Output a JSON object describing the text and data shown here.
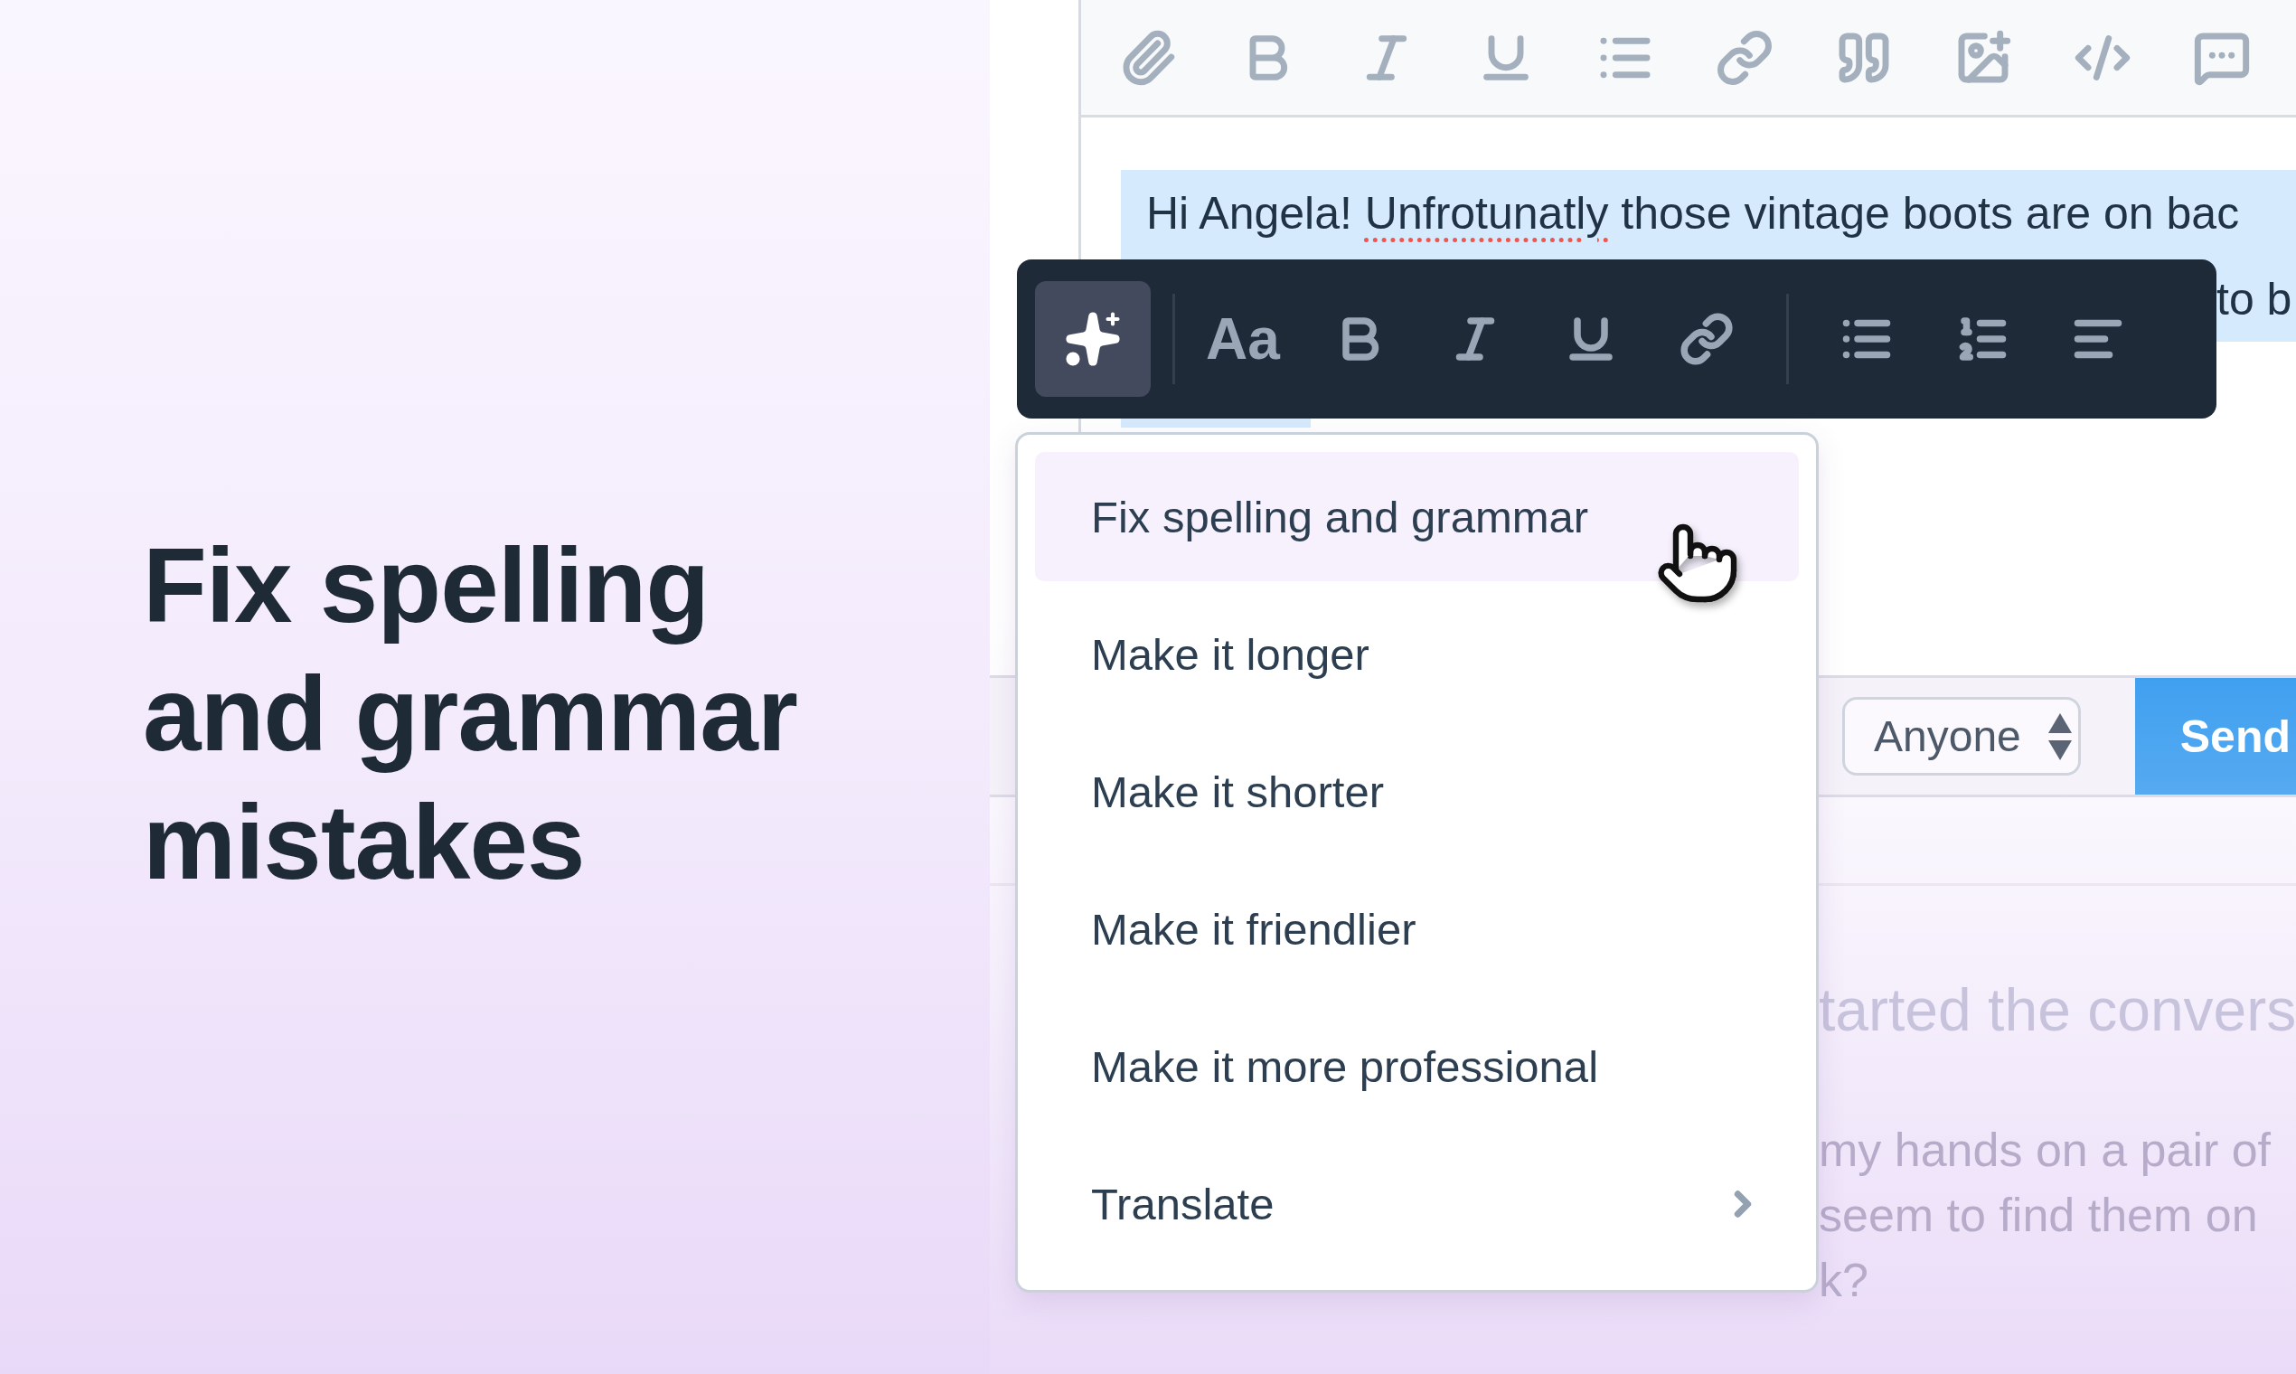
{
  "headline": "Fix spelling and grammar mistakes",
  "editor": {
    "line_1": [
      {
        "text": "Hi Angela! ",
        "misspelled": false
      },
      {
        "text": "Unfrotunatly",
        "misspelled": true
      },
      {
        "text": " those vintage boots are on bac",
        "misspelled": false
      }
    ],
    "line_2": "to b"
  },
  "format_toolbar": {
    "ai_button": {
      "selected": true
    },
    "font_button": "Aa"
  },
  "menu": {
    "items": [
      {
        "label": "Fix spelling and grammar",
        "selected": true,
        "submenu": false
      },
      {
        "label": "Make it longer",
        "selected": false,
        "submenu": false
      },
      {
        "label": "Make it shorter",
        "selected": false,
        "submenu": false
      },
      {
        "label": "Make it friendlier",
        "selected": false,
        "submenu": false
      },
      {
        "label": "Make it more professional",
        "selected": false,
        "submenu": false
      },
      {
        "label": "Translate",
        "selected": false,
        "submenu": true
      }
    ]
  },
  "reply_bar": {
    "audience": "Anyone",
    "send": "Send"
  },
  "conversation": {
    "title": "tarted the convers",
    "lines": [
      "my hands on a pair of",
      "seem to find them on",
      "k?"
    ]
  }
}
